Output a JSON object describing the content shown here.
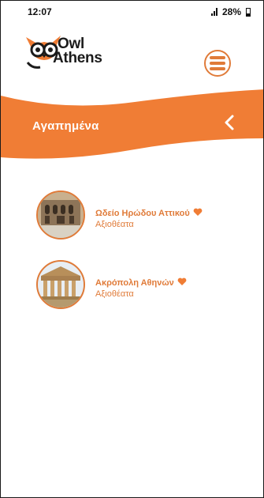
{
  "status": {
    "time": "12:07",
    "battery": "28%"
  },
  "app": {
    "brand_line1": "Owl",
    "brand_line2": "Athens"
  },
  "header": {
    "title": "Αγαπημένα"
  },
  "favorites": [
    {
      "title": "Ωδείο Ηρώδου Αττικού",
      "category": "Αξιοθέατα"
    },
    {
      "title": "Ακρόπολη Αθηνών",
      "category": "Αξιοθέατα"
    }
  ],
  "colors": {
    "accent": "#f07d35"
  }
}
